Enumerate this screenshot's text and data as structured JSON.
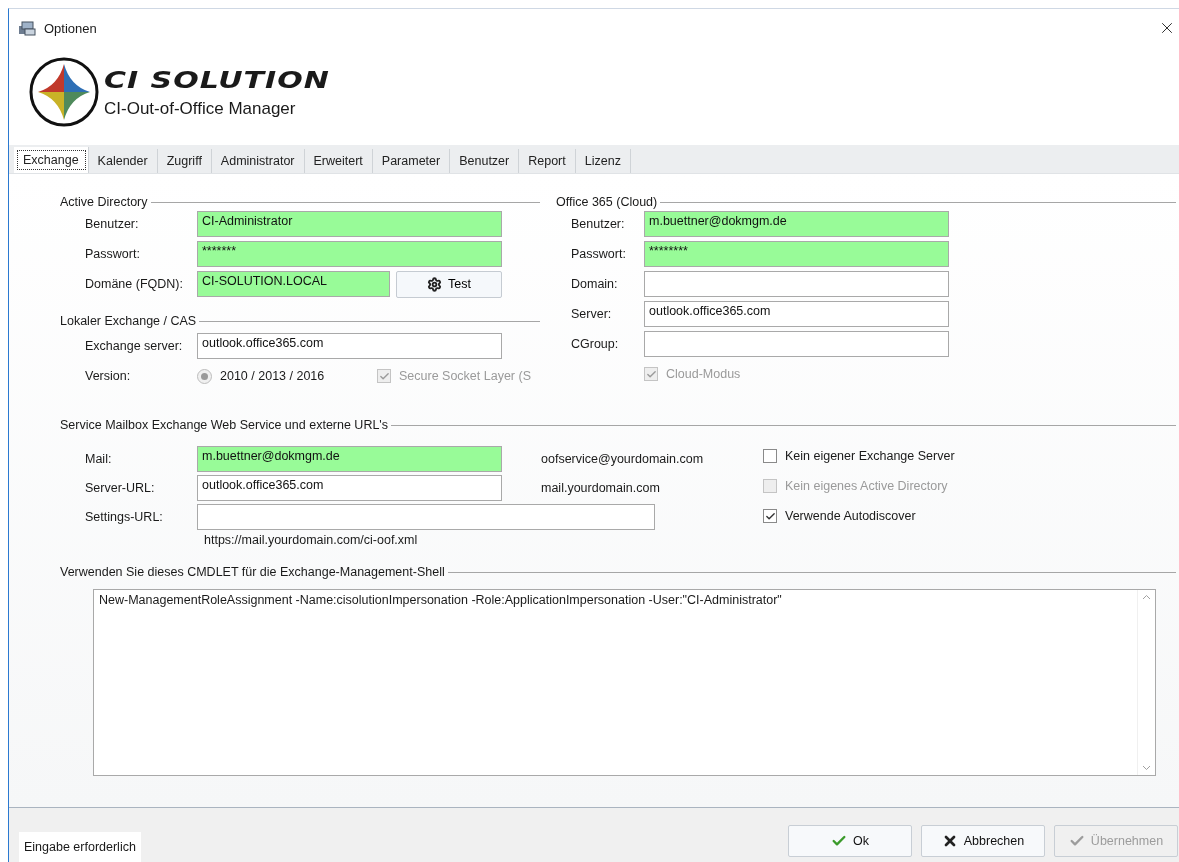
{
  "window": {
    "title": "Optionen"
  },
  "logo": {
    "brand": "CI SOLUTION",
    "product": "CI-Out-of-Office Manager"
  },
  "tabs": [
    {
      "label": "Exchange",
      "selected": true
    },
    {
      "label": "Kalender",
      "selected": false
    },
    {
      "label": "Zugriff",
      "selected": false
    },
    {
      "label": "Administrator",
      "selected": false
    },
    {
      "label": "Erweitert",
      "selected": false
    },
    {
      "label": "Parameter",
      "selected": false
    },
    {
      "label": "Benutzer",
      "selected": false
    },
    {
      "label": "Report",
      "selected": false
    },
    {
      "label": "Lizenz",
      "selected": false
    }
  ],
  "active_directory": {
    "title": "Active Directory",
    "fields": [
      {
        "label": "Benutzer:",
        "value": "CI-Administrator",
        "required": true
      },
      {
        "label": "Passwort:",
        "value": "*******",
        "required": true
      },
      {
        "label": "Domäne (FQDN):",
        "value": "CI-SOLUTION.LOCAL",
        "required": true
      }
    ],
    "test_button": "Test"
  },
  "local_exchange": {
    "title": "Lokaler Exchange / CAS",
    "server": {
      "label": "Exchange server:",
      "value": "outlook.office365.com",
      "required": false
    },
    "version_label": "Version:",
    "version_option": {
      "label": "2010 / 2013 / 2016",
      "selected": true,
      "disabled": true
    },
    "ssl": {
      "label": "Secure Socket Layer (S",
      "checked": true,
      "disabled": true
    }
  },
  "office365": {
    "title": "Office 365 (Cloud)",
    "fields": [
      {
        "label": "Benutzer:",
        "value": "m.buettner@dokmgm.de",
        "required": true
      },
      {
        "label": "Passwort:",
        "value": "********",
        "required": true
      },
      {
        "label": "Domain:",
        "required": false
      },
      {
        "label": "Server:",
        "value": "outlook.office365.com",
        "required": false
      },
      {
        "label": "CGroup:",
        "required": false
      }
    ],
    "cloud_mode": {
      "label": "Cloud-Modus",
      "checked": true,
      "disabled": true
    }
  },
  "service_mailbox": {
    "title": "Service Mailbox Exchange Web Service und externe URL's",
    "rows": [
      {
        "label": "Mail:",
        "value": "m.buettner@dokmgm.de",
        "required": true,
        "side_note": "oofservice@yourdomain.com"
      },
      {
        "label": "Server-URL:",
        "value": "outlook.office365.com",
        "required": false,
        "side_note": "mail.yourdomain.com"
      },
      {
        "label": "Settings-URL:",
        "required": false,
        "wide": true
      }
    ],
    "example": "https://mail.yourdomain.com/ci-oof.xml",
    "options": [
      {
        "label": "Kein eigener Exchange Server",
        "checked": false,
        "disabled": false
      },
      {
        "label": "Kein eigenes Active Directory",
        "checked": false,
        "disabled": true
      },
      {
        "label": "Verwende Autodiscover",
        "checked": true,
        "disabled": false
      }
    ]
  },
  "cmdlet": {
    "title": "Verwenden Sie dieses CMDLET für die Exchange-Management-Shell",
    "text": "New-ManagementRoleAssignment -Name:cisolutionImpersonation -Role:ApplicationImpersonation -User:\"CI-Administrator\""
  },
  "status": "Eingabe erforderlich",
  "buttons": [
    {
      "label": "Ok",
      "kind": "ok",
      "disabled": false
    },
    {
      "label": "Abbrechen",
      "kind": "cancel",
      "disabled": false
    },
    {
      "label": "Übernehmen",
      "kind": "apply",
      "disabled": true
    }
  ]
}
